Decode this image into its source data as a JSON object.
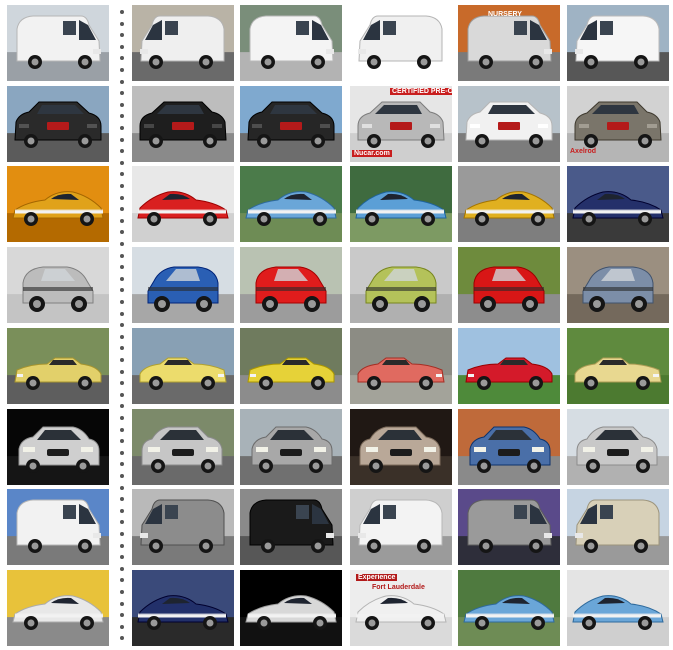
{
  "title": "",
  "query_column_label": "",
  "overlay_text": {
    "nucar": "Nucar.com",
    "axelrod": "Axelrod",
    "certified": "CERTIFIED PRE-OWNED",
    "experience": "Experience",
    "ftlauderdale": "Fort Lauderdale",
    "nursery": "NURSERY"
  },
  "rows": [
    {
      "class": "mercedes-sprinter-van",
      "cells": [
        {
          "body": "van",
          "color": "#f2f2f2",
          "bg": "#cfd6dc",
          "ground": "#9aa0a6"
        },
        {
          "body": "van",
          "color": "#efefef",
          "bg": "#b9b3a6",
          "ground": "#6a6a6a"
        },
        {
          "body": "van",
          "color": "#f4f4f4",
          "bg": "#7a8e7a",
          "ground": "#b3b3b3"
        },
        {
          "body": "van",
          "color": "#f0f0f0",
          "bg": "#ffffff",
          "ground": "#ffffff"
        },
        {
          "body": "van",
          "color": "#d9d9d9",
          "bg": "#c86a2a",
          "ground": "#7a7a7a"
        },
        {
          "body": "van",
          "color": "#f6f6f6",
          "bg": "#9fb3c4",
          "ground": "#575757"
        }
      ]
    },
    {
      "class": "gmc-terrain-suv",
      "cells": [
        {
          "body": "suv",
          "color": "#2a2a2a",
          "bg": "#8aa6c0",
          "ground": "#5b5b5b"
        },
        {
          "body": "suv",
          "color": "#1e1e1e",
          "bg": "#bdbdbd",
          "ground": "#8a8a8a"
        },
        {
          "body": "suv",
          "color": "#262626",
          "bg": "#7fa9cf",
          "ground": "#6d6d6d"
        },
        {
          "body": "suv",
          "color": "#b8b8b8",
          "bg": "#e6e6e6",
          "ground": "#cfcfcf"
        },
        {
          "body": "suv",
          "color": "#f1f1f1",
          "bg": "#b7c2ca",
          "ground": "#7c7c7c"
        },
        {
          "body": "suv",
          "color": "#7a756a",
          "bg": "#d2d2d2",
          "ground": "#b5b5b5"
        }
      ]
    },
    {
      "class": "ford-gt-supercar",
      "cells": [
        {
          "body": "sport",
          "color": "#e0a21a",
          "bg": "#e28e10",
          "ground": "#b46a00"
        },
        {
          "body": "sport",
          "color": "#d92020",
          "bg": "#e8e8e8",
          "ground": "#d0d0d0"
        },
        {
          "body": "sport",
          "color": "#6aa6d8",
          "bg": "#4b7b4a",
          "ground": "#6e8c55"
        },
        {
          "body": "sport",
          "color": "#5b9fd6",
          "bg": "#3f6b3f",
          "ground": "#7d9a63"
        },
        {
          "body": "sport",
          "color": "#e0b020",
          "bg": "#9a9a9a",
          "ground": "#7e7e7e"
        },
        {
          "body": "sport",
          "color": "#24306a",
          "bg": "#4a5a8a",
          "ground": "#3a3a3a"
        }
      ]
    },
    {
      "class": "smart-fortwo-cabrio",
      "cells": [
        {
          "body": "smart",
          "color": "#bcbcbc",
          "bg": "#d8d8d8",
          "ground": "#c4c4c4"
        },
        {
          "body": "smart",
          "color": "#2a5fb4",
          "bg": "#d6dde3",
          "ground": "#a7a7a7"
        },
        {
          "body": "smart",
          "color": "#e01c1c",
          "bg": "#b9c2b2",
          "ground": "#9c9c9c"
        },
        {
          "body": "smart",
          "color": "#b4c25a",
          "bg": "#c9c9c9",
          "ground": "#b0b0b0"
        },
        {
          "body": "smart",
          "color": "#d81616",
          "bg": "#6e8b3d",
          "ground": "#8d8d8d"
        },
        {
          "body": "smart",
          "color": "#7c8ea8",
          "bg": "#9b8f80",
          "ground": "#74695c"
        }
      ]
    },
    {
      "class": "geo-metro-convertible",
      "cells": [
        {
          "body": "conv",
          "color": "#e2d06a",
          "bg": "#7a8f5a",
          "ground": "#5e5e5e"
        },
        {
          "body": "conv",
          "color": "#ecdc6c",
          "bg": "#88a0b4",
          "ground": "#6a6a6a"
        },
        {
          "body": "conv",
          "color": "#e6d238",
          "bg": "#6f7b5e",
          "ground": "#8c8c8c"
        },
        {
          "body": "conv",
          "color": "#e06a60",
          "bg": "#8c8c84",
          "ground": "#a3a39a"
        },
        {
          "body": "conv",
          "color": "#d41a2a",
          "bg": "#9fc1e0",
          "ground": "#4e8a3a"
        },
        {
          "body": "conv",
          "color": "#e8d890",
          "bg": "#5f8a3e",
          "ground": "#4c7a30"
        }
      ]
    },
    {
      "class": "suzuki-swift-hatch",
      "cells": [
        {
          "body": "hatch",
          "color": "#cfcfcf",
          "bg": "#060606",
          "ground": "#151515"
        },
        {
          "body": "hatch",
          "color": "#c6c6c6",
          "bg": "#7c8a6a",
          "ground": "#6a6a6a"
        },
        {
          "body": "hatch",
          "color": "#a8a8a8",
          "bg": "#a8b2b8",
          "ground": "#707070"
        },
        {
          "body": "hatch",
          "color": "#b9a898",
          "bg": "#201814",
          "ground": "#3a3028"
        },
        {
          "body": "hatch",
          "color": "#4a6fa8",
          "bg": "#bf6a3a",
          "ground": "#8a8a8a"
        },
        {
          "body": "hatch",
          "color": "#c8c8c8",
          "bg": "#d6dde3",
          "ground": "#b1b1b1"
        }
      ]
    },
    {
      "class": "mercedes-sprinter-van-2",
      "cells": [
        {
          "body": "van",
          "color": "#f2f2f2",
          "bg": "#5a86c8",
          "ground": "#7a7a7a"
        },
        {
          "body": "van",
          "color": "#8c8c8c",
          "bg": "#b9b9b9",
          "ground": "#7a7a7a"
        },
        {
          "body": "van",
          "color": "#1a1a1a",
          "bg": "#8a8a8a",
          "ground": "#575757"
        },
        {
          "body": "van",
          "color": "#f3f3f3",
          "bg": "#cfcfcf",
          "ground": "#9b9b9b"
        },
        {
          "body": "van",
          "color": "#9a9a9a",
          "bg": "#5a4a8a",
          "ground": "#2e2e3a"
        },
        {
          "body": "van",
          "color": "#d8d0b8",
          "bg": "#c6d4e2",
          "ground": "#9a9a9a"
        }
      ]
    },
    {
      "class": "ford-gt-supercar-2",
      "cells": [
        {
          "body": "sport",
          "color": "#e8e8e8",
          "bg": "#e8c23a",
          "ground": "#8a8a8a"
        },
        {
          "body": "sport",
          "color": "#22306a",
          "bg": "#3a4a7a",
          "ground": "#2a2a2a"
        },
        {
          "body": "sport",
          "color": "#d8d8d8",
          "bg": "#000000",
          "ground": "#111111"
        },
        {
          "body": "sport",
          "color": "#f0f0f0",
          "bg": "#ededed",
          "ground": "#dadada"
        },
        {
          "body": "sport",
          "color": "#6aa6d8",
          "bg": "#4f7a3f",
          "ground": "#6e8c55"
        },
        {
          "body": "sport",
          "color": "#6aa6d8",
          "bg": "#e4e4e4",
          "ground": "#cfcfcf"
        }
      ]
    }
  ]
}
